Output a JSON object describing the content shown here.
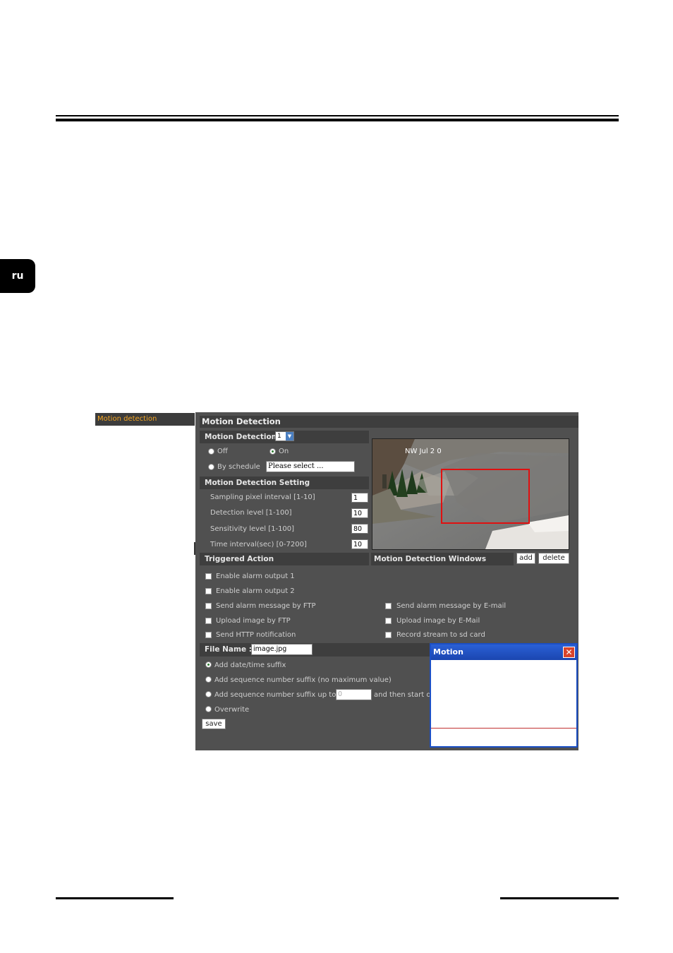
{
  "page": {
    "lang_tab": "ru"
  },
  "nav": {
    "motion_detection": "Motion detection"
  },
  "panel": {
    "title": "Motion Detection",
    "md_label": "Motion Detection",
    "md_select": "1",
    "off": "Off",
    "on": "On",
    "by_schedule": "By schedule",
    "schedule_value": "Please select ...",
    "setting_title": "Motion Detection Setting",
    "sampling_label": "Sampling pixel interval [1-10]",
    "sampling_value": "1",
    "detection_label": "Detection level [1-100]",
    "detection_value": "10",
    "sensitivity_label": "Sensitivity level [1-100]",
    "sensitivity_value": "80",
    "time_label": "Time interval(sec) [0-7200]",
    "time_value": "10",
    "camera_overlay": "NW  Jul 2 0",
    "triggered_title": "Triggered Action",
    "windows_title": "Motion Detection Windows",
    "add_label": "add",
    "delete_label": "delete",
    "alarm1": "Enable alarm output 1",
    "alarm2": "Enable alarm output 2",
    "ftp_msg": "Send alarm message by FTP",
    "email_msg": "Send alarm message by E-mail",
    "ftp_upload": "Upload image by FTP",
    "email_upload": "Upload image by E-Mail",
    "http_notify": "Send HTTP notification",
    "sd_record": "Record stream to sd card",
    "file_name_label": "File Name :",
    "file_name_value": "image.jpg",
    "opt_datetime": "Add date/time suffix",
    "opt_seq_nomax": "Add sequence number suffix (no maximum value)",
    "opt_seq_upto": "Add sequence number suffix up to",
    "seq_upto_value": "0",
    "seq_then": "and then start o",
    "opt_overwrite": "Overwrite",
    "save_label": "save"
  },
  "popup": {
    "title": "Motion",
    "close": "✕"
  },
  "colors": {
    "panel_bg": "#505050",
    "section_bg": "#3e3e3e",
    "nav_text": "#f5a623",
    "popup_border": "#1b4fc4",
    "detection_box": "#e01010"
  }
}
